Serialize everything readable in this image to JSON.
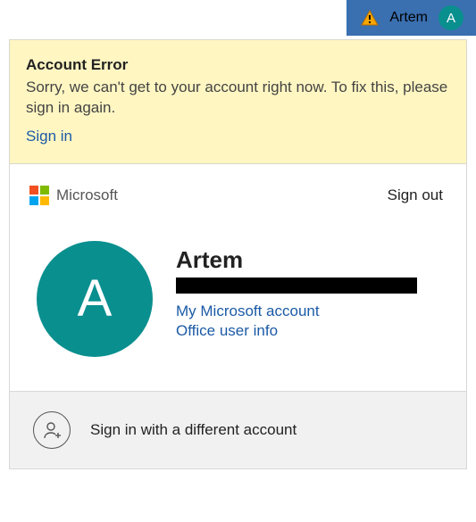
{
  "header": {
    "username": "Artem",
    "avatar_initial": "A"
  },
  "error": {
    "title": "Account Error",
    "message": "Sorry, we can't get to your account right now. To fix this, please sign in again.",
    "signin_label": "Sign in"
  },
  "brand": {
    "name": "Microsoft"
  },
  "signout_label": "Sign out",
  "profile": {
    "avatar_initial": "A",
    "name": "Artem",
    "link_ms_account": "My Microsoft account",
    "link_office_info": "Office user info"
  },
  "alt_signin_label": "Sign in with a different account"
}
